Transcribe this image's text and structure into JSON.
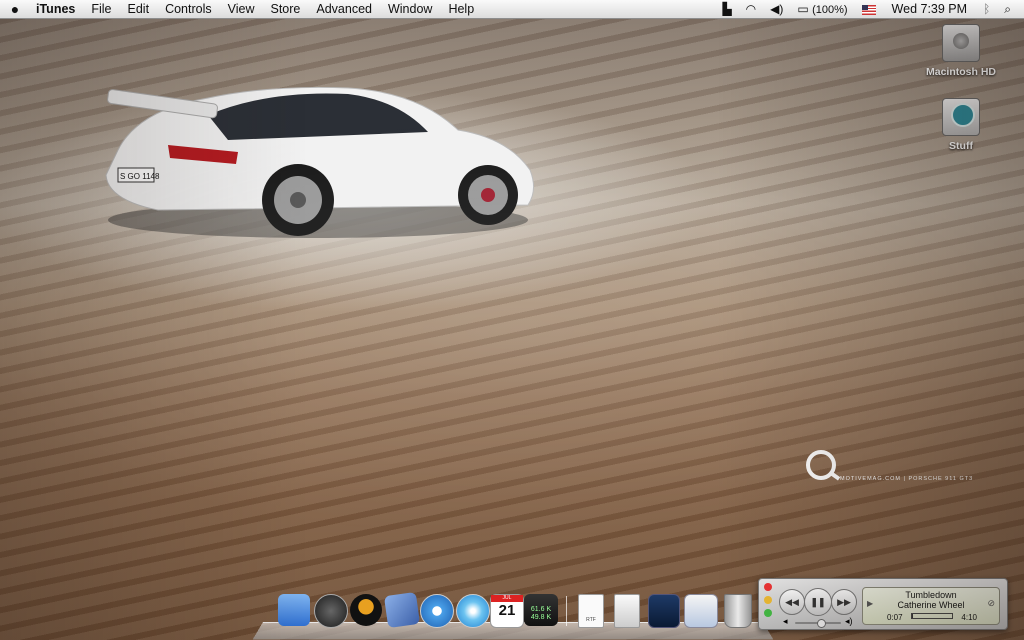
{
  "menubar": {
    "apple_icon": "apple-icon",
    "app_name": "iTunes",
    "menus": [
      "File",
      "Edit",
      "Controls",
      "View",
      "Store",
      "Advanced",
      "Window",
      "Help"
    ],
    "battery_text": "(100%)",
    "clock": "Wed 7:39 PM"
  },
  "desktop_icons": [
    {
      "label": "Macintosh HD"
    },
    {
      "label": "Stuff"
    }
  ],
  "car": {
    "plate": "S GO 1148"
  },
  "watermark": {
    "text": "MOTIVEMAG.COM | PORSCHE 911 GT3"
  },
  "dock": {
    "calendar_day": "21",
    "calendar_month": "JUL",
    "net_up": "61.6 K",
    "net_down": "49.8 K",
    "doc_label": "RTF"
  },
  "mini_player": {
    "track": "Tumbledown",
    "artist": "Catherine Wheel",
    "elapsed": "0:07",
    "duration": "4:10",
    "progress": 0.03,
    "volume": 0.55
  },
  "colors": {
    "desktop_brown": "#8e6e54",
    "menubar": "#e8e8e8"
  }
}
